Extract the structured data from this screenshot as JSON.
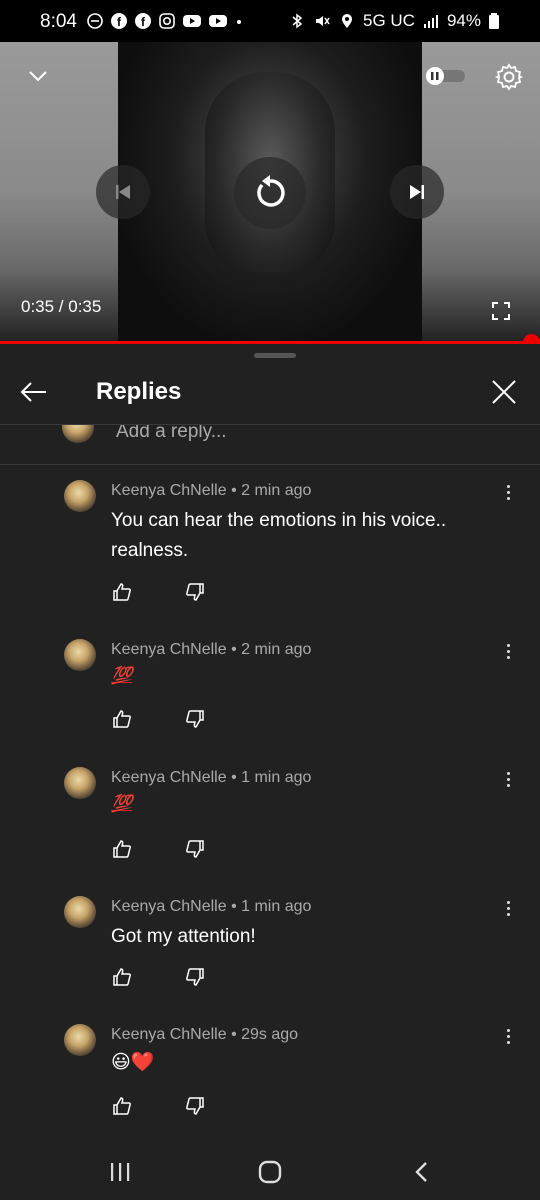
{
  "status_bar": {
    "time": "8:04",
    "network": "5G UC",
    "battery": "94%",
    "icons": [
      "minus-circle-icon",
      "facebook-icon",
      "facebook-icon",
      "instagram-icon",
      "youtube-icon",
      "youtube-icon",
      "dot-icon",
      "bluetooth-icon",
      "mute-icon",
      "location-icon",
      "signal-icon",
      "battery-icon"
    ]
  },
  "player": {
    "time_display": "0:35 / 0:35",
    "progress": 1.0,
    "autoplay_on": false,
    "icons": [
      "chevron-down-icon",
      "autoplay-toggle-icon",
      "settings-icon",
      "previous-icon",
      "replay-icon",
      "next-icon",
      "fullscreen-icon"
    ]
  },
  "replies": {
    "title": "Replies",
    "add_reply_placeholder": "Add a reply...",
    "comments": [
      {
        "author": "Keenya ChNelle",
        "time": "2 min ago",
        "meta": "Keenya ChNelle • 2 min ago",
        "text": "You can hear the emotions in his voice.. realness."
      },
      {
        "author": "Keenya ChNelle",
        "time": "2 min ago",
        "meta": "Keenya ChNelle • 2 min ago",
        "text": "💯"
      },
      {
        "author": "Keenya ChNelle",
        "time": "1 min ago",
        "meta": "Keenya ChNelle • 1 min ago",
        "text": "💯"
      },
      {
        "author": "Keenya ChNelle",
        "time": "1 min ago",
        "meta": "Keenya ChNelle • 1 min ago",
        "text": "Got my attention!"
      },
      {
        "author": "Keenya ChNelle",
        "time": "29s ago",
        "meta": "Keenya ChNelle • 29s ago",
        "text": "😃❤️"
      }
    ]
  },
  "nav": {
    "icons": [
      "recent-apps-icon",
      "home-icon",
      "back-icon"
    ]
  },
  "colors": {
    "accent": "#ff0000",
    "sheet_bg": "#212121",
    "meta_text": "#aaaaaa"
  }
}
